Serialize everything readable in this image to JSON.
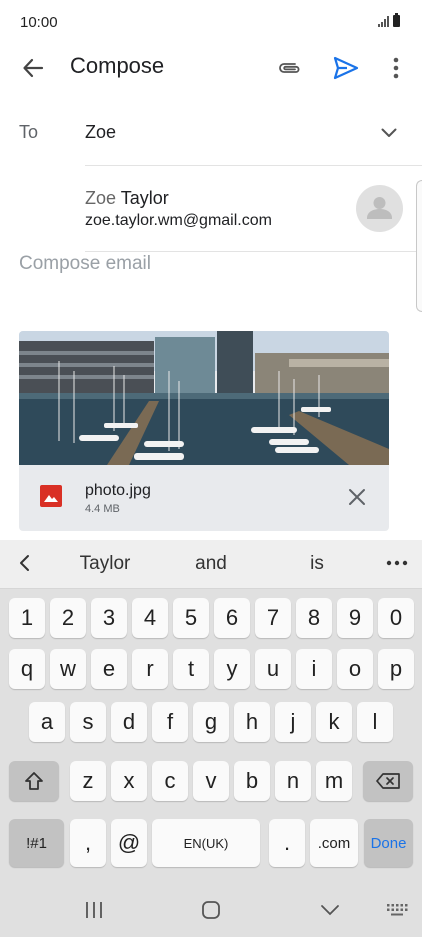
{
  "status": {
    "time": "10:00"
  },
  "appbar": {
    "title": "Compose",
    "colors": {
      "send": "#1a73e8"
    }
  },
  "recipient": {
    "to_label": "To",
    "to_value": "Zoe"
  },
  "suggestion": {
    "name_typed": "Zoe",
    "name_rest": " Taylor",
    "email": "zoe.taylor.wm@gmail.com"
  },
  "body": {
    "placeholder": "Compose email"
  },
  "attachment": {
    "file_name": "photo.jpg",
    "file_size": "4.4 MB"
  },
  "keyboard": {
    "predictions": [
      "Taylor",
      "and",
      "is"
    ],
    "row_numbers": [
      "1",
      "2",
      "3",
      "4",
      "5",
      "6",
      "7",
      "8",
      "9",
      "0"
    ],
    "row1": [
      "q",
      "w",
      "e",
      "r",
      "t",
      "y",
      "u",
      "i",
      "o",
      "p"
    ],
    "row2": [
      "a",
      "s",
      "d",
      "f",
      "g",
      "h",
      "j",
      "k",
      "l"
    ],
    "row3": [
      "z",
      "x",
      "c",
      "v",
      "b",
      "n",
      "m"
    ],
    "symbols_label": "!#1",
    "comma": ",",
    "at": "@",
    "space_label": "EN(UK)",
    "period": ".",
    "dotcom": ".com",
    "done_label": "Done"
  }
}
